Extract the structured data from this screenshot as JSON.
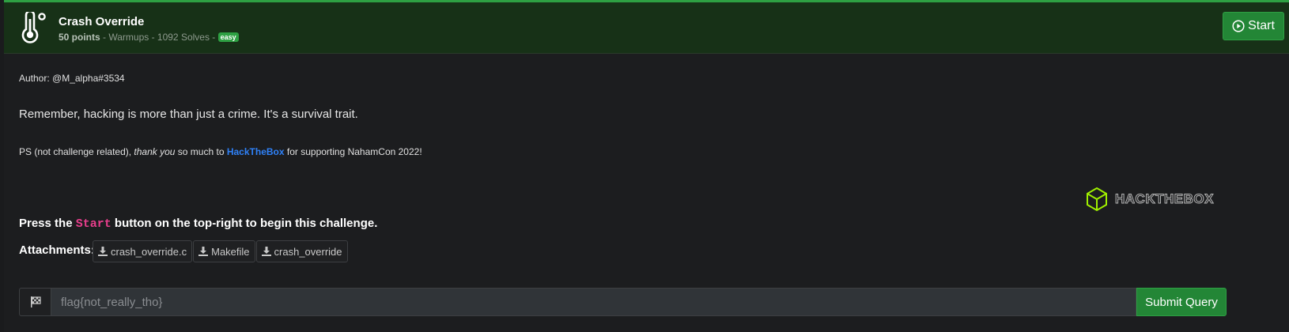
{
  "challenge": {
    "title": "Crash Override",
    "points": "50 points",
    "meta_rest": " - Warmups - 1092 Solves - ",
    "difficulty": "easy",
    "start_label": "Start"
  },
  "description": {
    "author": "Author: @M_alpha#3534",
    "text": "Remember, hacking is more than just a crime. It's a survival trait.",
    "ps_prefix": "PS (not challenge related), ",
    "ps_italic": "thank you",
    "ps_mid": " so much to ",
    "ps_link": "HackTheBox",
    "ps_suffix": " for supporting NahamCon 2022!",
    "sponsor_logo_text": "HACKTHEBOX"
  },
  "instructions": {
    "prefix": "Press the ",
    "code": "Start",
    "suffix": " button on the top-right to begin this challenge."
  },
  "attachments": {
    "label": "Attachments:",
    "files": [
      "crash_override.c",
      "Makefile",
      "crash_override"
    ]
  },
  "flag_form": {
    "placeholder": "flag{not_really_tho}",
    "submit_label": "Submit Query"
  },
  "colors": {
    "accent": "#2ea043",
    "header_bg": "#173117",
    "link": "#2f81f7",
    "code": "#e83e8c"
  }
}
